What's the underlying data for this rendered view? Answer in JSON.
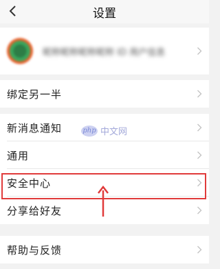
{
  "navbar": {
    "title": "设置"
  },
  "profile": {
    "name_blurred": "昵称昵称昵称昵称  ID 用户信息"
  },
  "items": {
    "bind_partner": "绑定另一半",
    "notifications": "新消息通知",
    "general": "通用",
    "security_center": "安全中心",
    "share": "分享给好友",
    "help_feedback": "帮助与反馈"
  },
  "watermark": {
    "logo": "php",
    "text": "中文网"
  },
  "colors": {
    "highlight": "#e03a3a",
    "background": "#f2f2f2"
  },
  "icons": {
    "back": "chevron-left-icon",
    "row": "chevron-right-icon"
  }
}
